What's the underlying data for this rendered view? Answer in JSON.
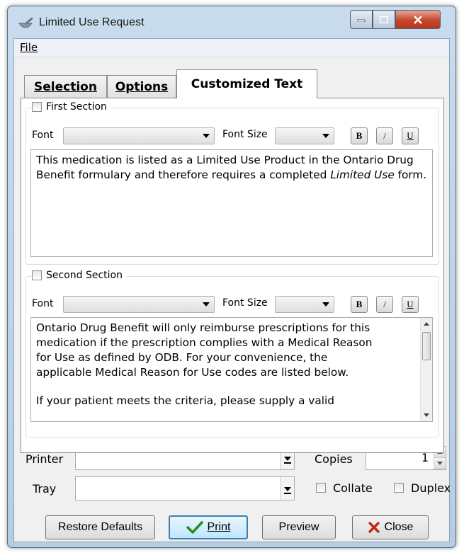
{
  "window": {
    "title": "Limited Use Request"
  },
  "menu": {
    "file": "File"
  },
  "tabs": {
    "selection": "Selection",
    "options": "Options",
    "customized_text": "Customized Text"
  },
  "first_section": {
    "legend": "First Section",
    "font_label": "Font",
    "font_size_label": "Font Size",
    "bold": "B",
    "italic": "/",
    "underline": "U",
    "text_1": "This medication is listed as a Limited Use Product in the Ontario Drug Benefit formulary and therefore requires a completed ",
    "text_italic": "Limited Use",
    "text_2": " form."
  },
  "second_section": {
    "legend": "Second Section",
    "font_label": "Font",
    "font_size_label": "Font Size",
    "bold": "B",
    "italic": "/",
    "underline": "U",
    "line_1": "Ontario Drug Benefit will only reimburse prescriptions for this",
    "line_2": "medication if the prescription complies with a Medical Reason",
    "line_3": "for Use as defined by ODB. For your convenience, the",
    "line_4": "applicable Medical Reason for Use codes are listed below.",
    "line_5": "If your patient meets the criteria, please supply a valid"
  },
  "print": {
    "printer_label": "Printer",
    "tray_label": "Tray",
    "copies_label": "Copies",
    "copies_value": "1",
    "collate_label": "Collate",
    "duplex_label": "Duplex"
  },
  "buttons": {
    "restore_defaults": "Restore Defaults",
    "print": "Print",
    "preview": "Preview",
    "close": "Close"
  },
  "colors": {
    "close_x": "#c0281c",
    "checkmark": "#2e8b22",
    "accent_border": "#3c7fb1"
  }
}
